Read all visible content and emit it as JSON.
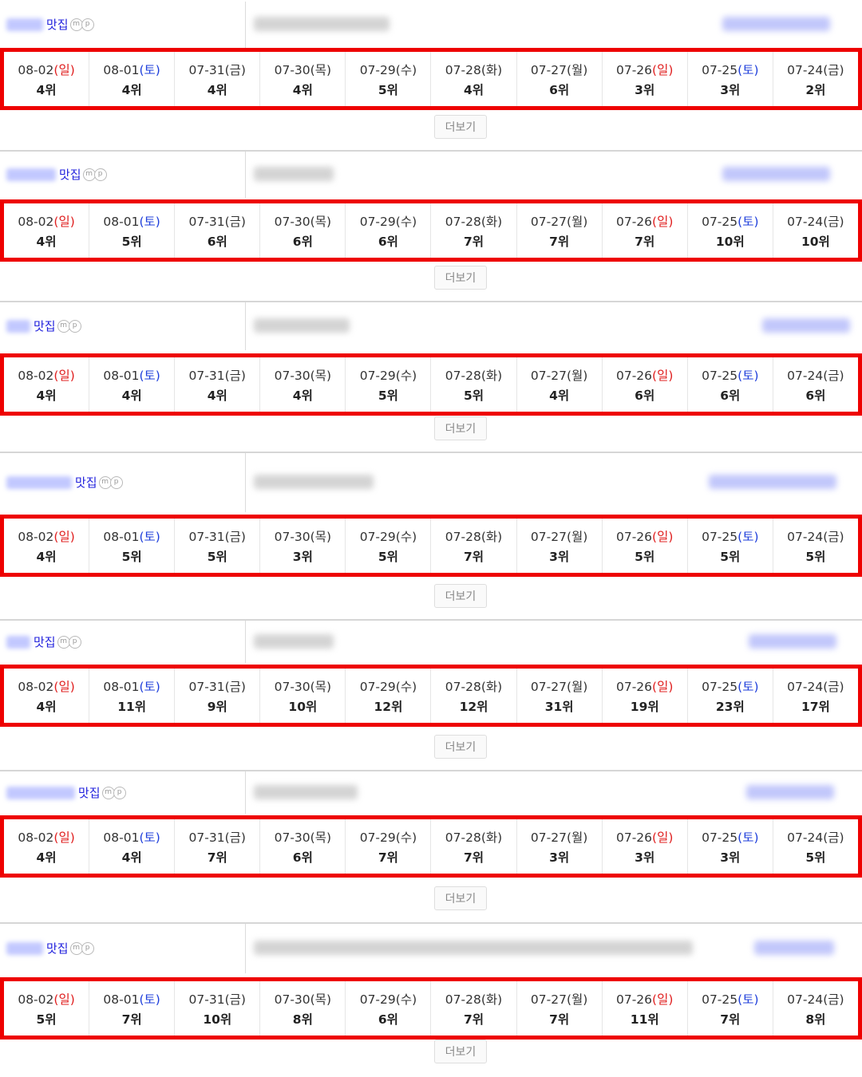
{
  "more_label": "더보기",
  "badge_m": "m",
  "badge_p": "p",
  "dates": [
    {
      "date": "08-02",
      "day": "일"
    },
    {
      "date": "08-01",
      "day": "토"
    },
    {
      "date": "07-31",
      "day": "금"
    },
    {
      "date": "07-30",
      "day": "목"
    },
    {
      "date": "07-29",
      "day": "수"
    },
    {
      "date": "07-28",
      "day": "화"
    },
    {
      "date": "07-27",
      "day": "월"
    },
    {
      "date": "07-26",
      "day": "일"
    },
    {
      "date": "07-25",
      "day": "토"
    },
    {
      "date": "07-24",
      "day": "금"
    }
  ],
  "keywords": [
    {
      "suffix": "맛집",
      "ranks": [
        "4위",
        "4위",
        "4위",
        "4위",
        "5위",
        "4위",
        "6위",
        "3위",
        "3위",
        "2위"
      ]
    },
    {
      "suffix": "맛집",
      "ranks": [
        "4위",
        "5위",
        "6위",
        "6위",
        "6위",
        "7위",
        "7위",
        "7위",
        "10위",
        "10위"
      ]
    },
    {
      "suffix": "맛집",
      "ranks": [
        "4위",
        "4위",
        "4위",
        "4위",
        "5위",
        "5위",
        "4위",
        "6위",
        "6위",
        "6위"
      ]
    },
    {
      "suffix": "맛집",
      "ranks": [
        "4위",
        "5위",
        "5위",
        "3위",
        "5위",
        "7위",
        "3위",
        "5위",
        "5위",
        "5위"
      ]
    },
    {
      "suffix": "맛집",
      "ranks": [
        "4위",
        "11위",
        "9위",
        "10위",
        "12위",
        "12위",
        "31위",
        "19위",
        "23위",
        "17위"
      ]
    },
    {
      "suffix": "맛집",
      "ranks": [
        "4위",
        "4위",
        "7위",
        "6위",
        "7위",
        "7위",
        "3위",
        "3위",
        "3위",
        "5위"
      ]
    },
    {
      "suffix": "맛집",
      "ranks": [
        "5위",
        "7위",
        "10위",
        "8위",
        "6위",
        "7위",
        "7위",
        "11위",
        "7위",
        "8위"
      ]
    }
  ],
  "colors": {
    "sunday": "#e02020",
    "saturday": "#1f3fdb",
    "highlight": "#ee0000",
    "keyword": "#2222dd"
  }
}
